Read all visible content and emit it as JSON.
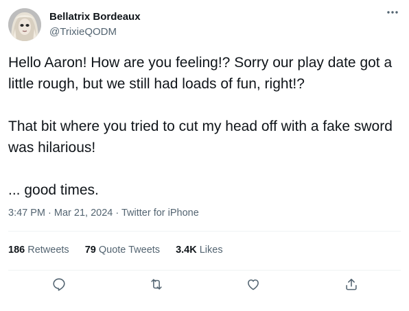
{
  "author": {
    "name": "Bellatrix Bordeaux",
    "handle": "@TrixieQODM"
  },
  "tweet": {
    "paragraphs": [
      "Hello Aaron! How are you feeling!? Sorry our play date got a little rough, but we still had loads of fun, right!?",
      "That bit where you tried to cut my head off with a fake sword was hilarious!",
      "... good times."
    ],
    "time": "3:47 PM",
    "sep1": " · ",
    "date": "Mar 21, 2024",
    "sep2": " · ",
    "source": "Twitter for iPhone"
  },
  "stats": {
    "retweets_count": "186",
    "retweets_label": "Retweets",
    "quotes_count": "79",
    "quotes_label": "Quote Tweets",
    "likes_count": "3.4K",
    "likes_label": "Likes"
  },
  "icons": {
    "more": "more-horizontal-icon",
    "reply": "reply-icon",
    "retweet": "retweet-icon",
    "like": "heart-icon",
    "share": "share-icon"
  },
  "colors": {
    "text": "#0f1419",
    "secondary": "#536471",
    "divider": "#eff3f4"
  }
}
